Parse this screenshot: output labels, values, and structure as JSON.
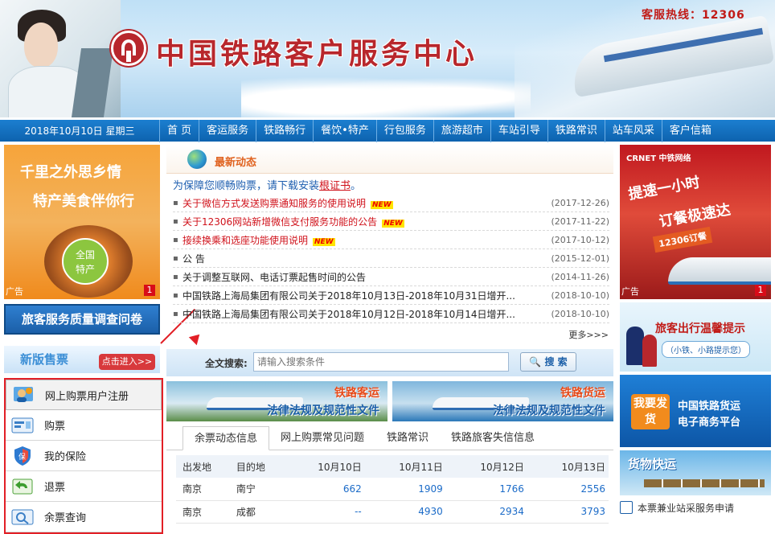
{
  "header": {
    "site_title": "中国铁路客户服务中心",
    "hotline": "客服热线：12306"
  },
  "nav": {
    "date": "2018年10月10日 星期三",
    "items": [
      "首 页",
      "客运服务",
      "铁路畅行",
      "餐饮•特产",
      "行包服务",
      "旅游超市",
      "车站引导",
      "铁路常识",
      "站车风采",
      "客户信箱"
    ]
  },
  "left": {
    "promo": {
      "line1": "千里之外思乡情",
      "line2": "特产美食伴你行",
      "badge_line1": "全国",
      "badge_line2": "特产",
      "ad_label": "广告",
      "ad_index": "1"
    },
    "survey_button": "旅客服务质量调查问卷",
    "new_ticket": {
      "label": "新版售票",
      "enter": "点击进入>>"
    },
    "menu": [
      {
        "label": "网上购票用户注册",
        "icon": "user-register-icon"
      },
      {
        "label": "购票",
        "icon": "ticket-purchase-icon"
      },
      {
        "label": "我的保险",
        "icon": "insurance-shield-icon"
      },
      {
        "label": "退票",
        "icon": "refund-arrow-icon"
      },
      {
        "label": "余票查询",
        "icon": "ticket-query-icon"
      }
    ]
  },
  "news": {
    "title": "最新动态",
    "notice_prefix": "为保障您顺畅购票，请下载安装",
    "notice_link": "根证书",
    "notice_suffix": "。",
    "items": [
      {
        "title": "关于微信方式发送购票通知服务的使用说明",
        "date": "(2017-12-26)",
        "new": true,
        "red": true
      },
      {
        "title": "关于12306网站新增微信支付服务功能的公告",
        "date": "(2017-11-22)",
        "new": true,
        "red": true
      },
      {
        "title": "接续换乘和选座功能使用说明",
        "date": "(2017-10-12)",
        "new": true,
        "red": true
      },
      {
        "title": "公 告",
        "date": "(2015-12-01)",
        "new": false,
        "red": false
      },
      {
        "title": "关于调整互联网、电话订票起售时间的公告",
        "date": "(2014-11-26)",
        "new": false,
        "red": false
      },
      {
        "title": "中国铁路上海局集团有限公司关于2018年10月13日-2018年10月31日增开...",
        "date": "(2018-10-10)",
        "new": false,
        "red": false
      },
      {
        "title": "中国铁路上海局集团有限公司关于2018年10月12日-2018年10月14日增开...",
        "date": "(2018-10-10)",
        "new": false,
        "red": false
      }
    ],
    "new_badge": "NEW",
    "more": "更多>>>"
  },
  "search": {
    "label": "全文搜索:",
    "placeholder": "请输入搜索条件",
    "button": "搜 索"
  },
  "banners": {
    "passenger_title": "铁路客运",
    "passenger_sub": "法律法规及规范性文件",
    "freight_title": "铁路货运",
    "freight_sub": "法律法规及规范性文件"
  },
  "tabs": [
    "余票动态信息",
    "网上购票常见问题",
    "铁路常识",
    "铁路旅客失信信息"
  ],
  "ticket_table": {
    "headers": [
      "出发地",
      "目的地",
      "10月10日",
      "10月11日",
      "10月12日",
      "10月13日"
    ],
    "rows": [
      [
        "南京",
        "南宁",
        "662",
        "1909",
        "1766",
        "2556"
      ],
      [
        "南京",
        "成都",
        "--",
        "4930",
        "2934",
        "3793"
      ]
    ]
  },
  "right": {
    "promo": {
      "brand": "CRNET 中铁网络",
      "line1": "提速一小时",
      "line2": "订餐极速达",
      "line3": "12306订餐",
      "ad_label": "广告",
      "ad_index": "1"
    },
    "travel_tips_title": "旅客出行温馨提示",
    "travel_tips_sub": "（小铁、小路提示您）",
    "freight_badge": "我要发货",
    "freight_line1": "中国铁路货运",
    "freight_line2": "电子商务平台",
    "cargo_fast": "货物快运",
    "bottom_link": "本票兼业站采服务申请"
  },
  "colors": {
    "brand_red": "#b8272c",
    "nav_blue": "#0d62ae",
    "highlight_red": "#e21f26"
  }
}
